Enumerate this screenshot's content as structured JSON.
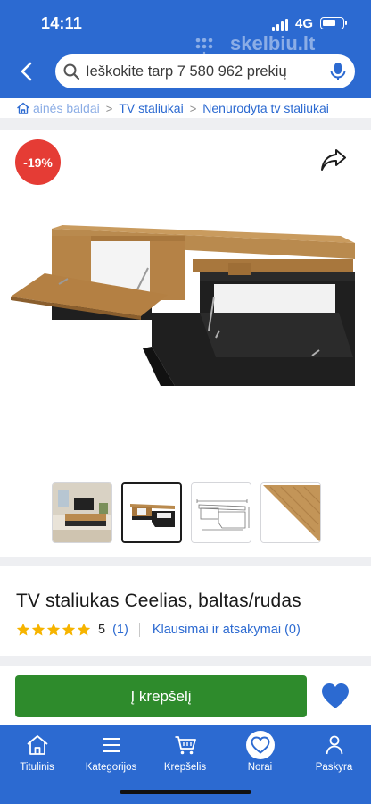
{
  "status": {
    "time": "14:11",
    "network": "4G"
  },
  "brand": {
    "name": "skelbiu.lt"
  },
  "search": {
    "placeholder": "Ieškokite tarp 7 580 962 prekių"
  },
  "breadcrumb": {
    "items": [
      {
        "label": "ainės baldai"
      },
      {
        "label": "TV staliukai"
      },
      {
        "label": "Nenurodyta tv staliukai"
      }
    ]
  },
  "product": {
    "discount_badge": "-19%",
    "title": "TV staliukas Ceelias, baltas/rudas",
    "rating_value": "5",
    "review_count": "(1)",
    "qa_link": "Klausimai ir atsakymai (0)",
    "stars": 5,
    "thumbnails": [
      "room-photo",
      "product-photo",
      "technical-drawing",
      "wood-swatch"
    ],
    "active_thumbnail": 1
  },
  "actions": {
    "add_to_cart": "Į krepšelį"
  },
  "nav": {
    "items": [
      {
        "label": "Titulinis",
        "icon": "home-icon"
      },
      {
        "label": "Kategorijos",
        "icon": "menu-icon"
      },
      {
        "label": "Krepšelis",
        "icon": "cart-icon"
      },
      {
        "label": "Norai",
        "icon": "heart-icon"
      },
      {
        "label": "Paskyra",
        "icon": "user-icon"
      }
    ],
    "active": "Norai"
  },
  "colors": {
    "primary": "#2c6ad1",
    "cart_button": "#2e8b2c",
    "discount": "#e53c35",
    "wood": "#b98a4e",
    "dark": "#1f1f1f"
  }
}
